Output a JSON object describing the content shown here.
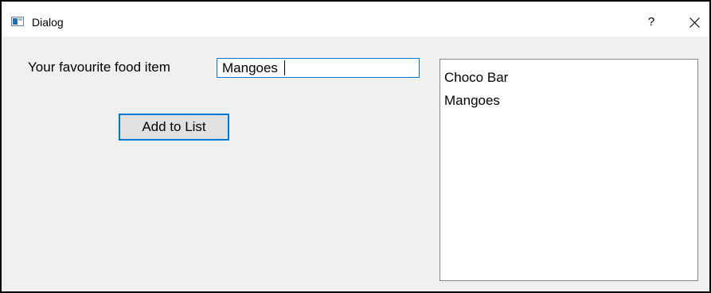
{
  "window": {
    "title": "Dialog",
    "help_label": "?",
    "icons": {
      "app": "window-icon",
      "close": "close-icon"
    }
  },
  "form": {
    "label": "Your favourite food item",
    "input_value": "Mangoes",
    "add_button_label": "Add to List"
  },
  "list": {
    "items": [
      "Choco Bar",
      "Mangoes"
    ]
  },
  "colors": {
    "accent": "#0078d7",
    "dialog_background": "#f0f0f0",
    "titlebar_background": "#ffffff",
    "list_border": "#828790"
  }
}
